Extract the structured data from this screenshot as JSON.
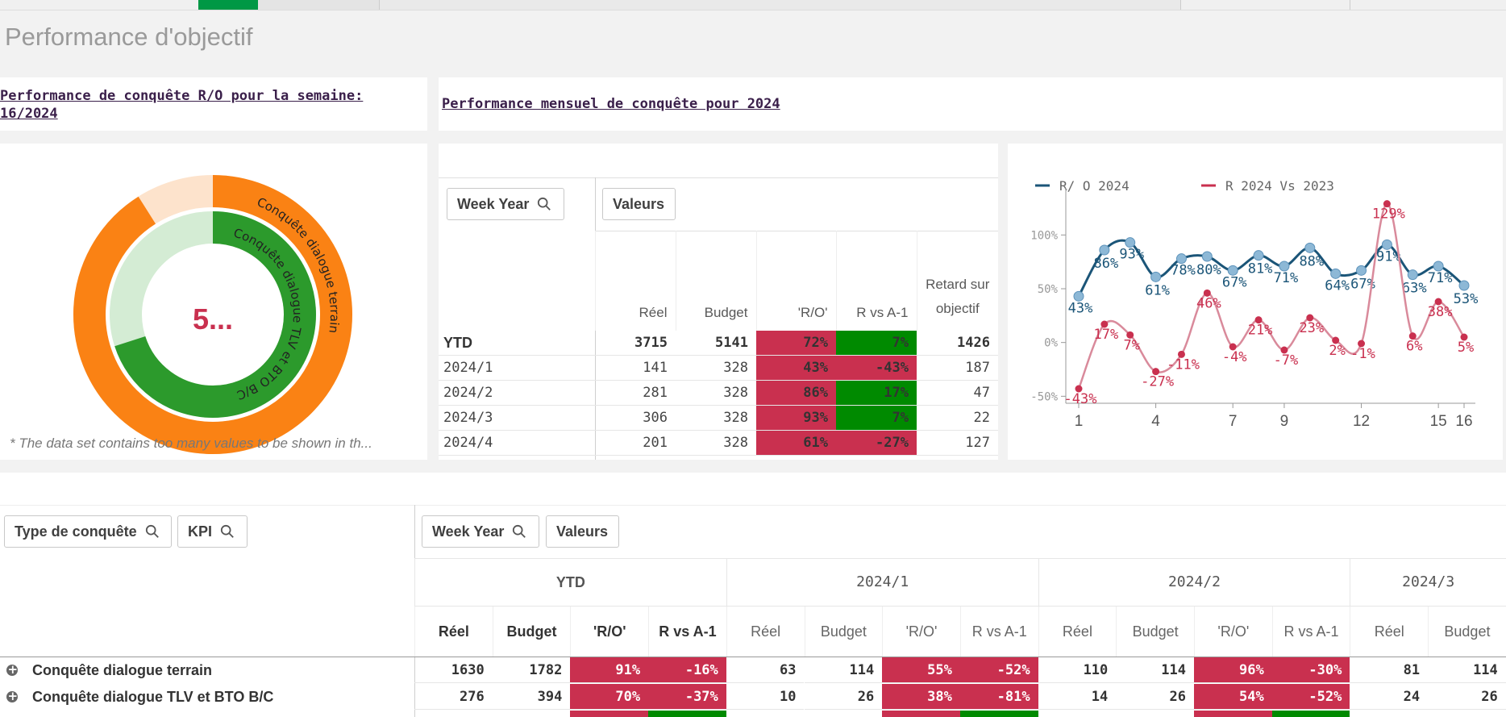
{
  "sheet_title": "Performance d'objectif",
  "colors": {
    "red": "#c9304f",
    "green": "#008a00",
    "orange": "#fa8214",
    "green_ring": "#2c9a2c",
    "navy": "#1b5578",
    "rose": "#c9304f"
  },
  "left_title": "Performance de conquête R/O pour la semaine: 16/2024",
  "right_title": "Performance mensuel de conquête pour 2024",
  "donut": {
    "center_value": "5...",
    "outer_label": "Conquête dialogue terrain",
    "inner_label": "Conquête dialogue TLV et BTO B/C",
    "outer_fraction": 0.91,
    "inner_fraction": 0.7,
    "footnote": "* The data set contains too many values to be shown in th..."
  },
  "pivot1": {
    "filter_week": "Week Year",
    "filter_values": "Valeurs",
    "headers": [
      "Réel",
      "Budget",
      "'R/O'",
      "R vs A-1",
      "Retard sur objectif"
    ],
    "rows": [
      {
        "label": "YTD",
        "reel": "3715",
        "budget": "5141",
        "ro": "72%",
        "rva": "7%",
        "retard": "1426",
        "ro_c": "red",
        "rva_c": "green"
      },
      {
        "label": "2024/1",
        "reel": "141",
        "budget": "328",
        "ro": "43%",
        "rva": "-43%",
        "retard": "187",
        "ro_c": "red",
        "rva_c": "red"
      },
      {
        "label": "2024/2",
        "reel": "281",
        "budget": "328",
        "ro": "86%",
        "rva": "17%",
        "retard": "47",
        "ro_c": "red",
        "rva_c": "green"
      },
      {
        "label": "2024/3",
        "reel": "306",
        "budget": "328",
        "ro": "93%",
        "rva": "7%",
        "retard": "22",
        "ro_c": "red",
        "rva_c": "green"
      },
      {
        "label": "2024/4",
        "reel": "201",
        "budget": "328",
        "ro": "61%",
        "rva": "-27%",
        "retard": "127",
        "ro_c": "red",
        "rva_c": "red"
      }
    ]
  },
  "chart_data": {
    "type": "line",
    "series": [
      {
        "name": "R/ O 2024",
        "color": "#1b5578",
        "x": [
          1,
          2,
          3,
          4,
          5,
          6,
          7,
          8,
          9,
          10,
          11,
          12,
          13,
          14,
          15,
          16
        ],
        "values": [
          43,
          86,
          93,
          61,
          78,
          80,
          67,
          81,
          71,
          88,
          64,
          67,
          91,
          63,
          71,
          53
        ],
        "labels": [
          "43%",
          "86%",
          "93%",
          "61%",
          "78%",
          "80%",
          "67%",
          "81%",
          "71%",
          "88%",
          "64%",
          "67%",
          "91%",
          "63%",
          "71%",
          "53%"
        ]
      },
      {
        "name": "R 2024 Vs 2023",
        "color": "#c9304f",
        "x": [
          1,
          2,
          3,
          4,
          5,
          6,
          7,
          8,
          9,
          10,
          11,
          12,
          13,
          14,
          15,
          16
        ],
        "values": [
          -43,
          17,
          7,
          -27,
          -11,
          46,
          -4,
          21,
          -7,
          23,
          2,
          -1,
          129,
          6,
          38,
          5
        ],
        "labels": [
          "-43%",
          "17%",
          "7%",
          "-27%",
          "-11%",
          "46%",
          "-4%",
          "21%",
          "-7%",
          "23%",
          "2%",
          "-1%",
          "129%",
          "6%",
          "38%",
          "5%"
        ]
      }
    ],
    "yticks": [
      "100%",
      "50%",
      "0%",
      "-50%"
    ],
    "ytick_values": [
      100,
      50,
      0,
      -50
    ],
    "xticks": [
      "1",
      "4",
      "7",
      "9",
      "12",
      "15",
      "16"
    ],
    "xtick_values": [
      1,
      4,
      7,
      9,
      12,
      15,
      16
    ],
    "ylim": [
      -55,
      140
    ],
    "xlim": [
      1,
      16
    ],
    "legend": "top-left"
  },
  "pivot2": {
    "filters": [
      "Type de conquête",
      "KPI"
    ],
    "filter_week": "Week Year",
    "filter_values": "Valeurs",
    "groups": [
      "YTD",
      "2024/1",
      "2024/2",
      "2024/3"
    ],
    "subheaders": [
      "Réel",
      "Budget",
      "'R/O'",
      "R vs A-1"
    ],
    "rows": [
      {
        "label": "Conquête dialogue terrain",
        "cells": [
          "1630",
          "1782",
          "91%",
          "-16%",
          "63",
          "114",
          "55%",
          "-52%",
          "110",
          "114",
          "96%",
          "-30%",
          "81",
          "114"
        ],
        "colors": [
          "",
          "",
          "red",
          "red",
          "",
          "",
          "red",
          "red",
          "",
          "",
          "red",
          "red",
          "",
          ""
        ]
      },
      {
        "label": "Conquête dialogue TLV et BTO B/C",
        "cells": [
          "276",
          "394",
          "70%",
          "-37%",
          "10",
          "26",
          "38%",
          "-81%",
          "14",
          "26",
          "54%",
          "-52%",
          "24",
          "26"
        ],
        "colors": [
          "",
          "",
          "red",
          "red",
          "",
          "",
          "red",
          "red",
          "",
          "",
          "red",
          "red",
          "",
          ""
        ]
      }
    ]
  }
}
